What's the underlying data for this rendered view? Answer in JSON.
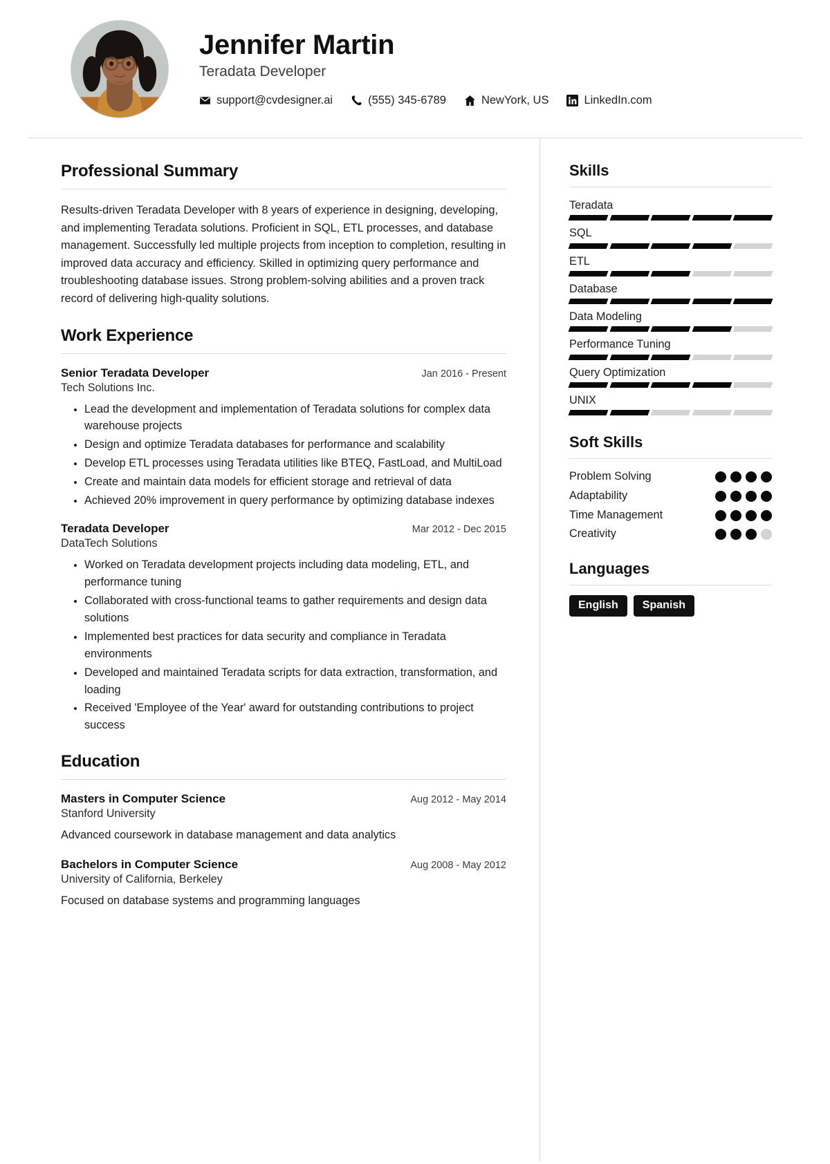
{
  "theme": {
    "accent": "#090909",
    "muted": "#d4d4d4",
    "rule": "#dcdcdc"
  },
  "header": {
    "name": "Jennifer Martin",
    "role": "Teradata Developer",
    "avatar_alt": "profile-photo",
    "contacts": [
      {
        "icon": "envelope-icon",
        "text": "support@cvdesigner.ai"
      },
      {
        "icon": "phone-icon",
        "text": "(555) 345-6789"
      },
      {
        "icon": "home-icon",
        "text": "NewYork, US"
      },
      {
        "icon": "linkedin-icon",
        "text": "LinkedIn.com"
      }
    ]
  },
  "main": {
    "summary": {
      "title": "Professional Summary",
      "text": "Results-driven Teradata Developer with 8 years of experience in designing, developing, and implementing Teradata solutions. Proficient in SQL, ETL processes, and database management. Successfully led multiple projects from inception to completion, resulting in improved data accuracy and efficiency. Skilled in optimizing query performance and troubleshooting database issues. Strong problem-solving abilities and a proven track record of delivering high-quality solutions."
    },
    "experience": {
      "title": "Work Experience",
      "jobs": [
        {
          "title": "Senior Teradata Developer",
          "date": "Jan 2016 - Present",
          "company": "Tech Solutions Inc.",
          "duties": [
            "Lead the development and implementation of Teradata solutions for complex data warehouse projects",
            "Design and optimize Teradata databases for performance and scalability",
            "Develop ETL processes using Teradata utilities like BTEQ, FastLoad, and MultiLoad",
            "Create and maintain data models for efficient storage and retrieval of data",
            "Achieved 20% improvement in query performance by optimizing database indexes"
          ]
        },
        {
          "title": "Teradata Developer",
          "date": "Mar 2012 - Dec 2015",
          "company": "DataTech Solutions",
          "duties": [
            "Worked on Teradata development projects including data modeling, ETL, and performance tuning",
            "Collaborated with cross-functional teams to gather requirements and design data solutions",
            "Implemented best practices for data security and compliance in Teradata environments",
            "Developed and maintained Teradata scripts for data extraction, transformation, and loading",
            "Received 'Employee of the Year' award for outstanding contributions to project success"
          ]
        }
      ]
    },
    "education": {
      "title": "Education",
      "items": [
        {
          "degree": "Masters in Computer Science",
          "date": "Aug 2012 - May 2014",
          "school": "Stanford University",
          "description": "Advanced coursework in database management and data analytics"
        },
        {
          "degree": "Bachelors in Computer Science",
          "date": "Aug 2008 - May 2012",
          "school": "University of California, Berkeley",
          "description": "Focused on database systems and programming languages"
        }
      ]
    }
  },
  "sidebar": {
    "skills": {
      "title": "Skills",
      "max": 5,
      "items": [
        {
          "name": "Teradata",
          "level": 5
        },
        {
          "name": "SQL",
          "level": 4
        },
        {
          "name": "ETL",
          "level": 3
        },
        {
          "name": "Database",
          "level": 5
        },
        {
          "name": "Data Modeling",
          "level": 4
        },
        {
          "name": "Performance Tuning",
          "level": 3
        },
        {
          "name": "Query Optimization",
          "level": 4
        },
        {
          "name": "UNIX",
          "level": 2
        }
      ]
    },
    "soft_skills": {
      "title": "Soft Skills",
      "max": 4,
      "items": [
        {
          "name": "Problem Solving",
          "level": 4
        },
        {
          "name": "Adaptability",
          "level": 4
        },
        {
          "name": "Time Management",
          "level": 4
        },
        {
          "name": "Creativity",
          "level": 3
        }
      ]
    },
    "languages": {
      "title": "Languages",
      "items": [
        "English",
        "Spanish"
      ]
    }
  }
}
